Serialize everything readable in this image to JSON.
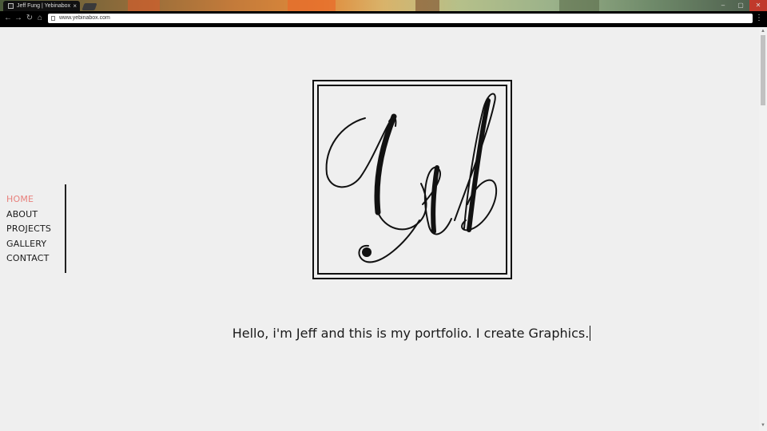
{
  "browser": {
    "tab_title": "Jeff Fung | Yebinabox",
    "tab_close": "×",
    "url": "www.yebinabox.com",
    "window_controls": {
      "minimize": "–",
      "maximize": "▢",
      "close": "✕"
    },
    "nav_icons": {
      "back": "←",
      "forward": "→",
      "reload": "↻",
      "home": "⌂",
      "menu": "⋮"
    }
  },
  "sidebar": {
    "items": [
      {
        "label": "HOME",
        "active": true
      },
      {
        "label": "ABOUT",
        "active": false
      },
      {
        "label": "PROJECTS",
        "active": false
      },
      {
        "label": "GALLERY",
        "active": false
      },
      {
        "label": "CONTACT",
        "active": false
      }
    ]
  },
  "logo": {
    "icon": "yeb-monogram-logo"
  },
  "hero": {
    "tagline": "Hello, i'm Jeff and this is my portfolio. I create Graphics."
  },
  "colors": {
    "accent": "#e8807c",
    "background": "#efefef",
    "text": "#1a1a1a"
  }
}
